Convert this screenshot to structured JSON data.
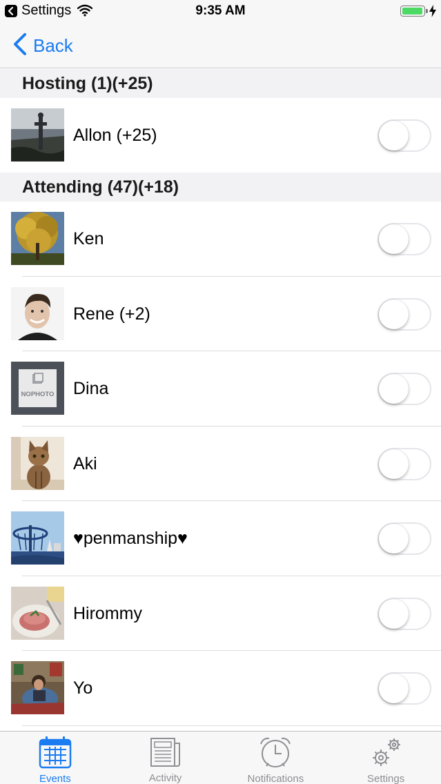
{
  "status_bar": {
    "back_app": "Settings",
    "time": "9:35 AM",
    "battery_level": 1.0,
    "charging": true
  },
  "nav": {
    "back_label": "Back",
    "accent_color": "#1a7cf0"
  },
  "sections": {
    "hosting": {
      "title": "Hosting (1)(+25)",
      "rows": [
        {
          "name": "Allon (+25)",
          "avatar": "photo-landscape-statue",
          "toggle_on": false
        }
      ]
    },
    "attending": {
      "title": "Attending (47)(+18)",
      "rows": [
        {
          "name": "Ken",
          "avatar": "photo-autumn-tree",
          "toggle_on": false
        },
        {
          "name": "Rene (+2)",
          "avatar": "photo-smiling-man",
          "toggle_on": false
        },
        {
          "name": "Dina",
          "avatar": "no-photo-placeholder",
          "toggle_on": false
        },
        {
          "name": "Aki",
          "avatar": "photo-cat",
          "toggle_on": false
        },
        {
          "name": "♥penmanship♥",
          "avatar": "photo-carnival-ride",
          "toggle_on": false
        },
        {
          "name": "Hirommy",
          "avatar": "photo-food-plate",
          "toggle_on": false
        },
        {
          "name": "Yo",
          "avatar": "photo-child-sitting",
          "toggle_on": false
        }
      ]
    }
  },
  "no_photo_text": "NOPHOTO",
  "tab_bar": {
    "tabs": [
      {
        "label": "Events",
        "icon": "calendar-icon",
        "active": true
      },
      {
        "label": "Activity",
        "icon": "newspaper-icon",
        "active": false
      },
      {
        "label": "Notifications",
        "icon": "alarm-clock-icon",
        "active": false
      },
      {
        "label": "Settings",
        "icon": "gears-icon",
        "active": false
      }
    ]
  }
}
